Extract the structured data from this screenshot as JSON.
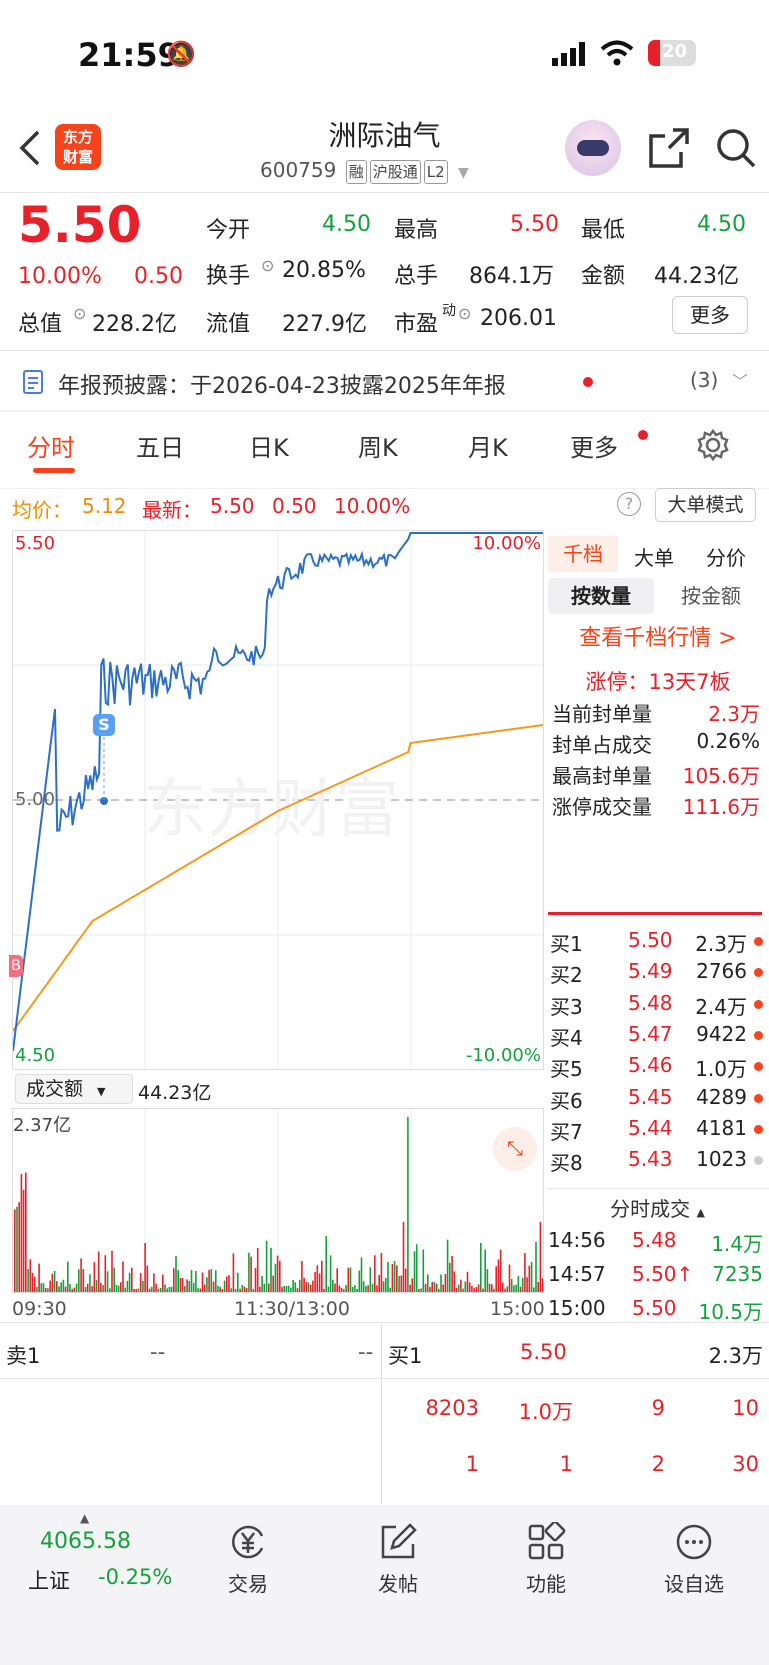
{
  "status_bar": {
    "time": "21:59",
    "battery": "20"
  },
  "header": {
    "title": "洲际油气",
    "code": "600759",
    "tags": [
      "融",
      "沪股通",
      "L2"
    ],
    "logo_line1": "东方",
    "logo_line2": "财富"
  },
  "quote": {
    "price": "5.50",
    "change_pct": "10.00%",
    "change": "0.50",
    "stats": [
      {
        "label": "今开",
        "value": "4.50"
      },
      {
        "label": "最高",
        "value": "5.50"
      },
      {
        "label": "最低",
        "value": "4.50"
      },
      {
        "label": "换手",
        "value": "20.85%"
      },
      {
        "label": "总手",
        "value": "864.1万"
      },
      {
        "label": "金额",
        "value": "44.23亿"
      },
      {
        "label": "总值",
        "value": "228.2亿"
      },
      {
        "label": "流值",
        "value": "227.9亿"
      },
      {
        "label": "市盈",
        "sup": "动",
        "value": "206.01"
      }
    ],
    "more_button": "更多"
  },
  "notice": {
    "text": "年报预披露：于2026-04-23披露2025年年报",
    "count": "(3)"
  },
  "tabs": [
    "分时",
    "五日",
    "日K",
    "周K",
    "月K",
    "更多"
  ],
  "info_line": {
    "avg_label": "均价：",
    "avg": "5.12",
    "latest_label": "最新：",
    "latest": "5.50",
    "chg": "0.50",
    "pct": "10.00%",
    "mode_button": "大单模式"
  },
  "chart_labels": {
    "top_price": "5.50",
    "mid_price": "5.00",
    "bottom_price": "4.50",
    "top_pct": "10.00%",
    "bottom_pct": "-10.00%",
    "s_marker": "S",
    "b_marker": "B",
    "watermark": "东方财富"
  },
  "volume": {
    "selector": "成交额",
    "total": "44.23亿",
    "max_label": "2.37亿",
    "times": [
      "09:30",
      "11:30/13:00",
      "15:00"
    ]
  },
  "panel": {
    "tabs": [
      "千档",
      "大单",
      "分价"
    ],
    "sub_tabs": [
      "按数量",
      "按金额"
    ],
    "link": "查看千档行情 >",
    "limit": "涨停：13天7板",
    "metrics": [
      {
        "label": "当前封单量",
        "value": "2.3万"
      },
      {
        "label": "封单占成交",
        "value": "0.26%"
      },
      {
        "label": "最高封单量",
        "value": "105.6万"
      },
      {
        "label": "涨停成交量",
        "value": "111.6万"
      }
    ],
    "bids": [
      {
        "label": "买1",
        "price": "5.50",
        "vol": "2.3万"
      },
      {
        "label": "买2",
        "price": "5.49",
        "vol": "2766"
      },
      {
        "label": "买3",
        "price": "5.48",
        "vol": "2.4万"
      },
      {
        "label": "买4",
        "price": "5.47",
        "vol": "9422"
      },
      {
        "label": "买5",
        "price": "5.46",
        "vol": "1.0万"
      },
      {
        "label": "买6",
        "price": "5.45",
        "vol": "4289"
      },
      {
        "label": "买7",
        "price": "5.44",
        "vol": "4181"
      },
      {
        "label": "买8",
        "price": "5.43",
        "vol": "1023"
      }
    ],
    "trades_title": "分时成交",
    "trades": [
      {
        "time": "14:56",
        "price": "5.48",
        "vol": "1.4万"
      },
      {
        "time": "14:57",
        "price": "5.50↑",
        "vol": "7235"
      },
      {
        "time": "15:00",
        "price": "5.50",
        "vol": "10.5万"
      }
    ]
  },
  "orderbook": {
    "sell_label": "卖1",
    "sell_price": "--",
    "sell_vol": "--",
    "buy_label": "买1",
    "buy_price": "5.50",
    "buy_vol": "2.3万",
    "row2": [
      "8203",
      "1.0万",
      "9",
      "10"
    ],
    "row3": [
      "1",
      "1",
      "2",
      "30"
    ]
  },
  "bottom_bar": {
    "index_value": "4065.58",
    "index_name": "上证",
    "index_change": "-0.25%",
    "items": [
      "交易",
      "发帖",
      "功能",
      "设自选"
    ]
  },
  "colors": {
    "up": "#e8202a",
    "down": "#14a03c",
    "price_line": "#2d6fc4",
    "avg_line": "#f39a1e",
    "accent": "#f5431c"
  }
}
